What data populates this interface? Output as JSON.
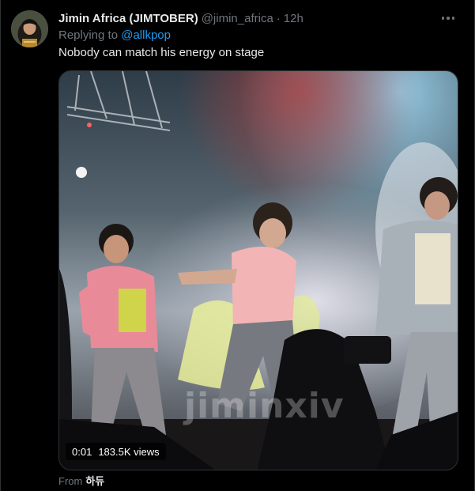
{
  "tweet": {
    "display_name": "Jimin Africa (JIMTOBER)",
    "handle": "@jimin_africa",
    "separator": "·",
    "timestamp": "12h",
    "reply_prefix": "Replying to",
    "reply_to": "@allkpop",
    "text": "Nobody can match his energy on stage",
    "source_prefix": "From",
    "source_name": "하듀"
  },
  "video": {
    "time": "0:01",
    "views": "183.5K views",
    "watermark": "jiminxiv"
  },
  "colors": {
    "background": "#000000",
    "text_primary": "#e7e9ea",
    "text_secondary": "#71767b",
    "link": "#1d9bf0"
  },
  "icons": {
    "more": "more-horizontal-icon"
  }
}
